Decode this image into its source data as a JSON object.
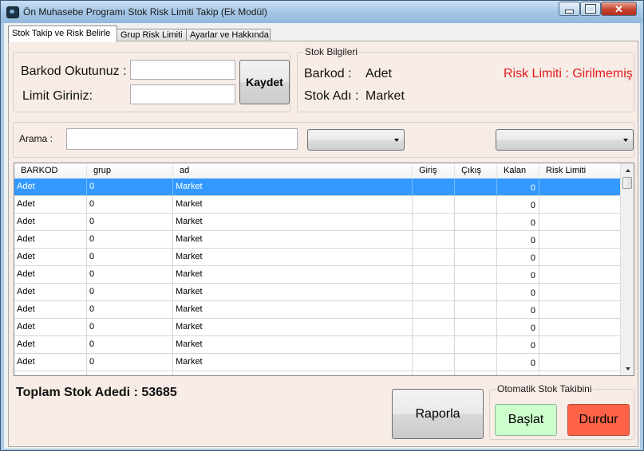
{
  "window": {
    "title": "Ön Muhasebe Programı Stok Risk Limiti Takip (Ek Modül)",
    "controls": {
      "minimize": "–",
      "maximize": "□",
      "close": "✕"
    }
  },
  "tabs": [
    {
      "label": "Stok Takip ve Risk Belirle",
      "active": true
    },
    {
      "label": "Grup Risk Limiti",
      "active": false
    },
    {
      "label": "Ayarlar ve Hakkında",
      "active": false
    }
  ],
  "input_form": {
    "barcode_label": "Barkod Okutunuz :",
    "barcode_value": "",
    "limit_label": "Limit Giriniz:",
    "limit_value": "",
    "save_label": "Kaydet"
  },
  "stock_info": {
    "legend": "Stok Bilgileri",
    "barcode_label": "Barkod :",
    "barcode_value": "Adet",
    "name_label": "Stok Adı :",
    "name_value": "Market",
    "risk_text": "Risk Limiti : Girilmemiş",
    "risk_color": "#e21b1b"
  },
  "search": {
    "label": "Arama :",
    "value": "",
    "combo1_value": "",
    "combo2_value": ""
  },
  "grid": {
    "columns": [
      "BARKOD",
      "grup",
      "ad",
      "Giriş",
      "Çıkış",
      "Kalan",
      "Risk Limiti"
    ],
    "rows": [
      [
        "Adet",
        "0",
        "Market",
        "",
        "",
        "0",
        ""
      ],
      [
        "Adet",
        "0",
        "Market",
        "",
        "",
        "0",
        ""
      ],
      [
        "Adet",
        "0",
        "Market",
        "",
        "",
        "0",
        ""
      ],
      [
        "Adet",
        "0",
        "Market",
        "",
        "",
        "0",
        ""
      ],
      [
        "Adet",
        "0",
        "Market",
        "",
        "",
        "0",
        ""
      ],
      [
        "Adet",
        "0",
        "Market",
        "",
        "",
        "0",
        ""
      ],
      [
        "Adet",
        "0",
        "Market",
        "",
        "",
        "0",
        ""
      ],
      [
        "Adet",
        "0",
        "Market",
        "",
        "",
        "0",
        ""
      ],
      [
        "Adet",
        "0",
        "Market",
        "",
        "",
        "0",
        ""
      ],
      [
        "Adet",
        "0",
        "Market",
        "",
        "",
        "0",
        ""
      ],
      [
        "Adet",
        "0",
        "Market",
        "",
        "",
        "0",
        ""
      ],
      [
        "",
        "",
        "",
        "",
        "",
        "",
        ""
      ]
    ],
    "selected_row": 0,
    "selection_color": "#3399ff"
  },
  "footer": {
    "total_text": "Toplam Stok Adedi : 53685",
    "report_label": "Raporla",
    "auto_legend": "Otomatik Stok Takibini",
    "start_label": "Başlat",
    "stop_label": "Durdur",
    "start_color": "#ccffcc",
    "stop_color": "#ff6347"
  }
}
